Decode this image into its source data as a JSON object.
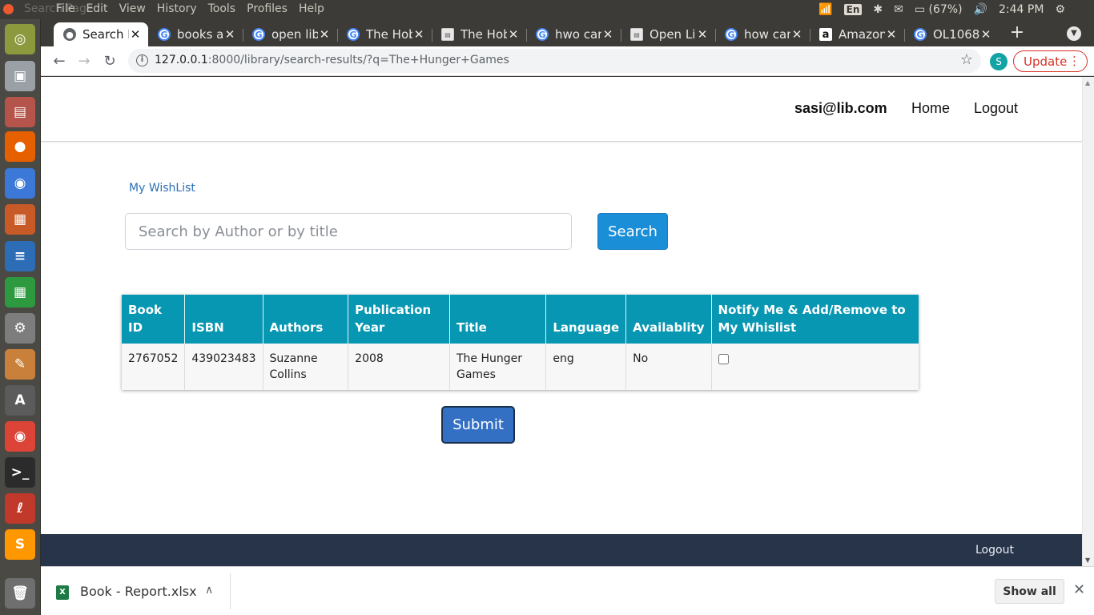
{
  "top_panel": {
    "ghost_title": "Search Page",
    "menus": [
      "File",
      "Edit",
      "View",
      "History",
      "Tools",
      "Profiles",
      "Help"
    ],
    "keyboard": "En",
    "battery": "(67%)",
    "time": "2:44 PM"
  },
  "launcher": {
    "items": [
      "ubuntu-dash",
      "files-archive",
      "file-cabinet",
      "firefox",
      "chromium",
      "impress",
      "writer",
      "calc",
      "settings",
      "text-editor",
      "software-updater",
      "chrome",
      "terminal",
      "evince",
      "sublime-text",
      "trash"
    ]
  },
  "tabs": [
    {
      "label": "Search Page",
      "icon": "globe-icon",
      "active": true
    },
    {
      "label": "books a",
      "icon": "google-icon"
    },
    {
      "label": "open lib",
      "icon": "google-icon"
    },
    {
      "label": "The Hob",
      "icon": "google-icon"
    },
    {
      "label": "The Hob",
      "icon": "doc-icon"
    },
    {
      "label": "hwo can",
      "icon": "google-icon"
    },
    {
      "label": "Open Li",
      "icon": "doc-icon"
    },
    {
      "label": "how can",
      "icon": "google-icon"
    },
    {
      "label": "Amazon",
      "icon": "amazon-icon"
    },
    {
      "label": "OL1068",
      "icon": "google-icon"
    }
  ],
  "toolbar": {
    "url_host": "127.0.0.1",
    "url_rest": ":8000/library/search-results/?q=The+Hunger+Games",
    "profile_initial": "S",
    "update_label": "Update"
  },
  "site": {
    "user_email": "sasi@lib.com",
    "nav_home": "Home",
    "nav_logout": "Logout",
    "wishlist_link": "My WishList",
    "search": {
      "placeholder": "Search by Author or by title",
      "value": "",
      "button_label": "Search"
    },
    "table": {
      "headers": [
        "Book ID",
        "ISBN",
        "Authors",
        "Publication Year",
        "Title",
        "Language",
        "Availablity",
        "Notify Me & Add/Remove to My Whislist"
      ],
      "rows": [
        {
          "book_id": "2767052",
          "isbn": "439023483",
          "authors": "Suzanne Collins",
          "year": "2008",
          "title": "The Hunger Games",
          "language": "eng",
          "availability": "No",
          "notify_checked": false
        }
      ]
    },
    "submit_label": "Submit",
    "footer_logout": "Logout"
  },
  "downloads": {
    "file_name": "Book - Report.xlsx",
    "show_all": "Show all"
  },
  "colors": {
    "table_header": "#0797b2",
    "search_button": "#1a8fd8",
    "submit_button": "#3370c4",
    "footer": "#27344a",
    "link": "#2a6fb7",
    "update_red": "#d93025"
  }
}
